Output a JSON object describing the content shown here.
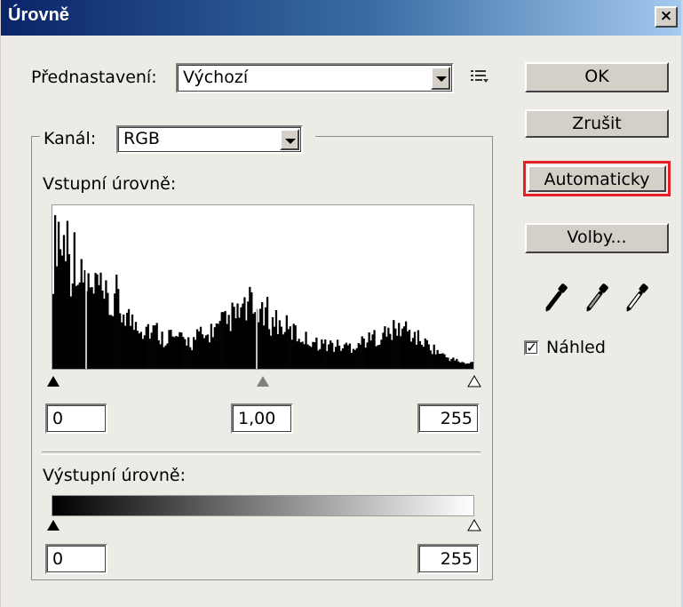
{
  "window": {
    "title": "Úrovně",
    "close_glyph": "×"
  },
  "preset": {
    "label": "Přednastavení:",
    "value": "Výchozí",
    "menu_icon": "preset-menu-icon"
  },
  "channel": {
    "label": "Kanál:",
    "value": "RGB"
  },
  "input_levels": {
    "label": "Vstupní úrovně:",
    "black": "0",
    "gamma": "1,00",
    "white": "255"
  },
  "output_levels": {
    "label": "Výstupní úrovně:",
    "black": "0",
    "white": "255"
  },
  "buttons": {
    "ok": "OK",
    "cancel": "Zrušit",
    "auto": "Automaticky",
    "options": "Volby..."
  },
  "preview": {
    "label": "Náhled",
    "checked": true
  },
  "colors": {
    "highlight_outline": "#e8202a",
    "title_gradient_start": "#0a246a"
  },
  "icons": [
    "black-eyedropper-icon",
    "gray-eyedropper-icon",
    "white-eyedropper-icon"
  ],
  "histogram": {
    "relative_heights": [
      0.72,
      1.0,
      0.78,
      0.95,
      0.66,
      0.82,
      0.58,
      0.62,
      0.55,
      0.48,
      0.6,
      0.44,
      0.47,
      0.38,
      0.52,
      0.36,
      0.4,
      0.34,
      0.3,
      0.33,
      0.26,
      0.3,
      0.24,
      0.27,
      0.22,
      0.2,
      0.25,
      0.19,
      0.22,
      0.18,
      0.2,
      0.17,
      0.21,
      0.23,
      0.2,
      0.24,
      0.28,
      0.26,
      0.32,
      0.3,
      0.36,
      0.34,
      0.4,
      0.38,
      0.44,
      0.36,
      0.42,
      0.33,
      0.38,
      0.3,
      0.34,
      0.27,
      0.3,
      0.24,
      0.26,
      0.21,
      0.22,
      0.19,
      0.2,
      0.17,
      0.18,
      0.16,
      0.17,
      0.15,
      0.16,
      0.14,
      0.16,
      0.15,
      0.17,
      0.18,
      0.2,
      0.19,
      0.22,
      0.21,
      0.24,
      0.23,
      0.26,
      0.25,
      0.28,
      0.27,
      0.24,
      0.22,
      0.2,
      0.18,
      0.16,
      0.14,
      0.12,
      0.1,
      0.08,
      0.07,
      0.06,
      0.05,
      0.04,
      0.03,
      0.05
    ]
  }
}
